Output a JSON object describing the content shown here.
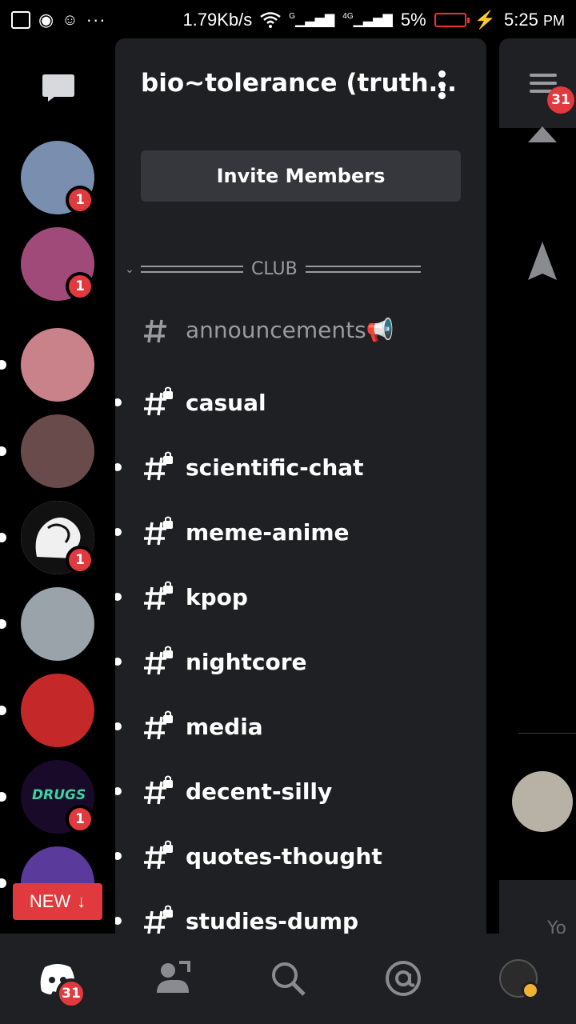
{
  "status_bar": {
    "speed": "1.79Kb/s",
    "battery": "5%",
    "time": "5:25",
    "ampm": "PM",
    "signal1": "G",
    "signal2": "4G",
    "dots": "···"
  },
  "rail": {
    "servers": [
      {
        "name": "cat-server",
        "badge": "1",
        "unread": false,
        "color": "#7a8fb0"
      },
      {
        "name": "pig-server",
        "badge": "1",
        "unread": false,
        "color": "#a04a7a"
      },
      {
        "name": "strawberry-server",
        "badge": "",
        "unread": true,
        "color": "#c9818a"
      },
      {
        "name": "girl-server",
        "badge": "",
        "unread": true,
        "color": "#6a4b4b"
      },
      {
        "name": "brain-server",
        "badge": "1",
        "unread": true,
        "color": "#f0f0f0"
      },
      {
        "name": "wanderer-server",
        "badge": "",
        "unread": true,
        "color": "#9aa2aa"
      },
      {
        "name": "truck-server",
        "badge": "",
        "unread": true,
        "color": "#c42828"
      },
      {
        "name": "drugs-server",
        "badge": "1",
        "unread": true,
        "color": "#1a0a2a"
      },
      {
        "name": "vaporwave-server",
        "badge": "",
        "unread": true,
        "color": "#5a3a9a"
      }
    ],
    "new_label": "NEW"
  },
  "panel": {
    "server_title": "bio~tolerance (truth...",
    "invite_label": "Invite Members",
    "category": "CLUB",
    "channels": [
      {
        "name": "announcements📢",
        "locked": false,
        "muted": true
      },
      {
        "name": "casual",
        "locked": true,
        "muted": false
      },
      {
        "name": "scientific-chat",
        "locked": true,
        "muted": false
      },
      {
        "name": "meme-anime",
        "locked": true,
        "muted": false
      },
      {
        "name": "kpop",
        "locked": true,
        "muted": false
      },
      {
        "name": "nightcore",
        "locked": true,
        "muted": false
      },
      {
        "name": "media",
        "locked": true,
        "muted": false
      },
      {
        "name": "decent-silly",
        "locked": true,
        "muted": false
      },
      {
        "name": "quotes-thought",
        "locked": true,
        "muted": false
      },
      {
        "name": "studies-dump",
        "locked": true,
        "muted": false
      }
    ]
  },
  "peek": {
    "badge": "31",
    "text": "Yo"
  },
  "bottom_nav": {
    "home_badge": "31"
  },
  "colors": {
    "accent_red": "#e0393e",
    "panel_bg": "#1f2024",
    "muted_text": "#9a9ba0"
  }
}
